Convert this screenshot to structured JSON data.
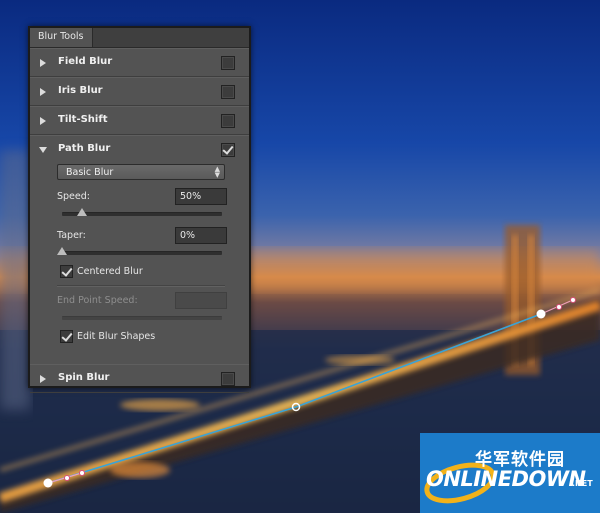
{
  "panel": {
    "tab_label": "Blur Tools",
    "sections": [
      {
        "label": "Field Blur",
        "checked": false,
        "expanded": false
      },
      {
        "label": "Iris Blur",
        "checked": false,
        "expanded": false
      },
      {
        "label": "Tilt-Shift",
        "checked": false,
        "expanded": false
      },
      {
        "label": "Path Blur",
        "checked": true,
        "expanded": true
      },
      {
        "label": "Spin Blur",
        "checked": false,
        "expanded": false
      }
    ],
    "path_blur": {
      "mode_selected": "Basic Blur",
      "speed_label": "Speed:",
      "speed_value": "50%",
      "speed_fraction": 0.1,
      "taper_label": "Taper:",
      "taper_value": "0%",
      "taper_fraction": 0.0,
      "centered_blur_label": "Centered Blur",
      "centered_blur_checked": true,
      "end_point_speed_label": "End Point Speed:",
      "end_point_speed_value": "",
      "edit_blur_shapes_label": "Edit Blur Shapes",
      "edit_blur_shapes_checked": true
    }
  },
  "watermark": {
    "chinese_text": "华军软件园",
    "brand": "ONLINEDOWN",
    "suffix": ".NET"
  },
  "colors": {
    "panel_bg": "#535353",
    "path_line": "#3aa3d6",
    "logo_bg": "#1c7bc9"
  }
}
